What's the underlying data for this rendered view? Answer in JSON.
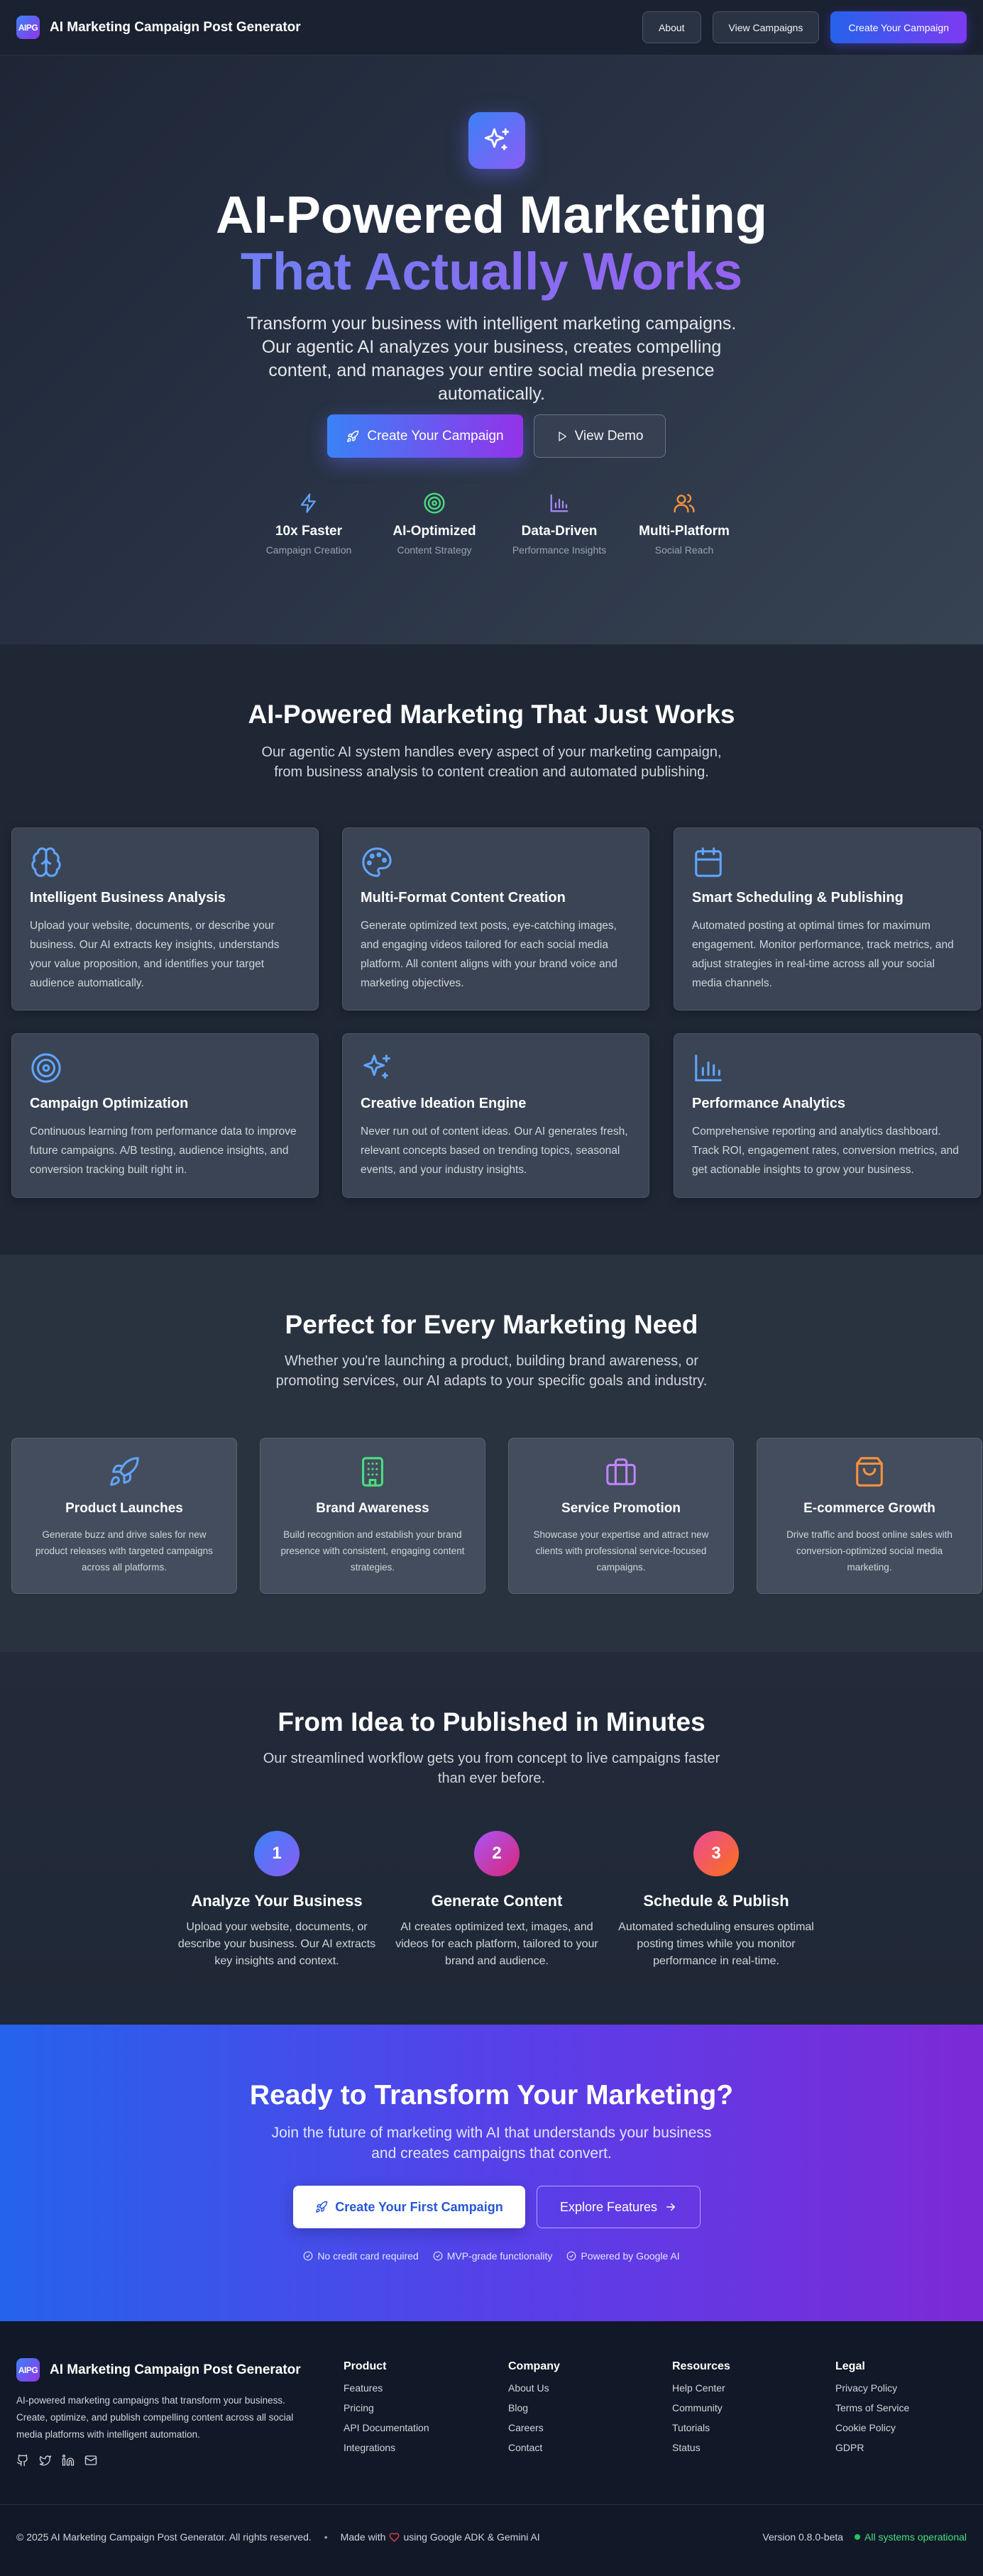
{
  "navbar": {
    "logo_text": "AIPG",
    "brand": "AI Marketing Campaign Post Generator",
    "about": "About",
    "view_campaigns": "View Campaigns",
    "create_campaign": "Create Your Campaign"
  },
  "hero": {
    "icon": "sparkles-icon",
    "title_line1": "AI-Powered Marketing",
    "title_line2": "That Actually Works",
    "subtitle": "Transform your business with intelligent marketing campaigns. Our agentic AI analyzes your business, creates compelling content, and manages your entire social media presence automatically.",
    "cta_primary": "Create Your Campaign",
    "cta_secondary": "View Demo",
    "stats": [
      {
        "icon": "zap-icon",
        "title": "10x Faster",
        "subtitle": "Campaign Creation",
        "color": "#60a5fa"
      },
      {
        "icon": "target-icon",
        "title": "AI-Optimized",
        "subtitle": "Content Strategy",
        "color": "#4ade80"
      },
      {
        "icon": "bar-chart-icon",
        "title": "Data-Driven",
        "subtitle": "Performance Insights",
        "color": "#a78bfa"
      },
      {
        "icon": "users-icon",
        "title": "Multi-Platform",
        "subtitle": "Social Reach",
        "color": "#fb923c"
      }
    ]
  },
  "features": {
    "title": "AI-Powered Marketing That Just Works",
    "subtitle": "Our agentic AI system handles every aspect of your marketing campaign, from business analysis to content creation and automated publishing.",
    "cards": [
      {
        "icon": "brain-icon",
        "title": "Intelligent Business Analysis",
        "desc": "Upload your website, documents, or describe your business. Our AI extracts key insights, understands your value proposition, and identifies your target audience automatically."
      },
      {
        "icon": "palette-icon",
        "title": "Multi-Format Content Creation",
        "desc": "Generate optimized text posts, eye-catching images, and engaging videos tailored for each social media platform. All content aligns with your brand voice and marketing objectives."
      },
      {
        "icon": "calendar-icon",
        "title": "Smart Scheduling & Publishing",
        "desc": "Automated posting at optimal times for maximum engagement. Monitor performance, track metrics, and adjust strategies in real-time across all your social media channels."
      },
      {
        "icon": "target-icon",
        "title": "Campaign Optimization",
        "desc": "Continuous learning from performance data to improve future campaigns. A/B testing, audience insights, and conversion tracking built right in."
      },
      {
        "icon": "sparkles-icon",
        "title": "Creative Ideation Engine",
        "desc": "Never run out of content ideas. Our AI generates fresh, relevant concepts based on trending topics, seasonal events, and your industry insights."
      },
      {
        "icon": "bar-chart-icon",
        "title": "Performance Analytics",
        "desc": "Comprehensive reporting and analytics dashboard. Track ROI, engagement rates, conversion metrics, and get actionable insights to grow your business."
      }
    ]
  },
  "usecases": {
    "title": "Perfect for Every Marketing Need",
    "subtitle": "Whether you're launching a product, building brand awareness, or promoting services, our AI adapts to your specific goals and industry.",
    "cards": [
      {
        "icon": "rocket-icon",
        "title": "Product Launches",
        "desc": "Generate buzz and drive sales for new product releases with targeted campaigns across all platforms.",
        "color": "#60a5fa"
      },
      {
        "icon": "building-icon",
        "title": "Brand Awareness",
        "desc": "Build recognition and establish your brand presence with consistent, engaging content strategies.",
        "color": "#4ade80"
      },
      {
        "icon": "briefcase-icon",
        "title": "Service Promotion",
        "desc": "Showcase your expertise and attract new clients with professional service-focused campaigns.",
        "color": "#c084fc"
      },
      {
        "icon": "shopping-bag-icon",
        "title": "E-commerce Growth",
        "desc": "Drive traffic and boost online sales with conversion-optimized social media marketing.",
        "color": "#fb923c"
      }
    ]
  },
  "workflow": {
    "title": "From Idea to Published in Minutes",
    "subtitle": "Our streamlined workflow gets you from concept to live campaigns faster than ever before.",
    "steps": [
      {
        "num": "1",
        "title": "Analyze Your Business",
        "desc": "Upload your website, documents, or describe your business. Our AI extracts key insights and context."
      },
      {
        "num": "2",
        "title": "Generate Content",
        "desc": "AI creates optimized text, images, and videos for each platform, tailored to your brand and audience."
      },
      {
        "num": "3",
        "title": "Schedule & Publish",
        "desc": "Automated scheduling ensures optimal posting times while you monitor performance in real-time."
      }
    ]
  },
  "cta": {
    "title": "Ready to Transform Your Marketing?",
    "subtitle": "Join the future of marketing with AI that understands your business and creates campaigns that convert.",
    "primary": "Create Your First Campaign",
    "secondary": "Explore Features",
    "notes": [
      "No credit card required",
      "MVP-grade functionality",
      "Powered by Google AI"
    ]
  },
  "footer": {
    "brand": "AI Marketing Campaign Post Generator",
    "description": "AI-powered marketing campaigns that transform your business. Create, optimize, and publish compelling content across all social media platforms with intelligent automation.",
    "columns": [
      {
        "heading": "Product",
        "links": [
          "Features",
          "Pricing",
          "API Documentation",
          "Integrations"
        ]
      },
      {
        "heading": "Company",
        "links": [
          "About Us",
          "Blog",
          "Careers",
          "Contact"
        ]
      },
      {
        "heading": "Resources",
        "links": [
          "Help Center",
          "Community",
          "Tutorials",
          "Status"
        ]
      },
      {
        "heading": "Legal",
        "links": [
          "Privacy Policy",
          "Terms of Service",
          "Cookie Policy",
          "GDPR"
        ]
      }
    ],
    "copyright": "© 2025 AI Marketing Campaign Post Generator. All rights reserved.",
    "separator": "•",
    "made_with_prefix": "Made with",
    "made_with_suffix": "using Google ADK & Gemini AI",
    "version": "Version 0.8.0-beta",
    "status": "All systems operational"
  }
}
